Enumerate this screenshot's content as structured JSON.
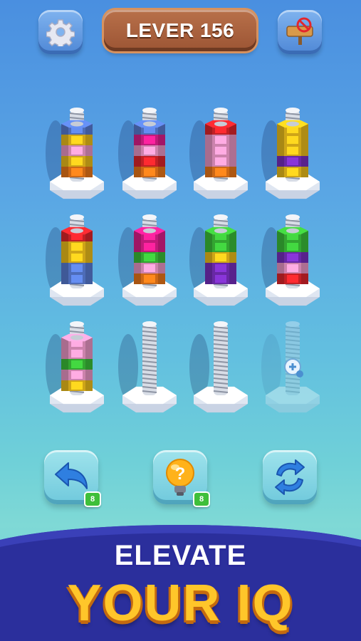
{
  "header": {
    "level_label": "LEVER 156",
    "settings_icon": "gear-icon",
    "no_ads_icon": "no-ads-icon"
  },
  "board": {
    "rows": [
      [
        {
          "nuts": [
            "orange",
            "yellow",
            "pink",
            "yellow",
            "blue"
          ]
        },
        {
          "nuts": [
            "orange",
            "red",
            "pink",
            "magenta",
            "blue"
          ]
        },
        {
          "nuts": [
            "orange",
            "pink",
            "pink",
            "pink",
            "red"
          ]
        },
        {
          "nuts": [
            "yellow",
            "purple",
            "yellow",
            "yellow",
            "yellow"
          ]
        }
      ],
      [
        {
          "nuts": [
            "blue",
            "blue",
            "yellow",
            "yellow",
            "red"
          ]
        },
        {
          "nuts": [
            "orange",
            "pink",
            "green",
            "magenta",
            "magenta"
          ]
        },
        {
          "nuts": [
            "purple",
            "purple",
            "yellow",
            "green",
            "green"
          ]
        },
        {
          "nuts": [
            "red",
            "pink",
            "purple",
            "green",
            "green"
          ]
        }
      ],
      [
        {
          "nuts": [
            "yellow",
            "pink",
            "green",
            "pink",
            "pink"
          ]
        },
        {
          "nuts": []
        },
        {
          "nuts": []
        },
        {
          "nuts": [],
          "locked": true
        }
      ]
    ],
    "colors": {
      "orange": "#f07a1a",
      "yellow": "#f2c21c",
      "pink": "#f09acb",
      "blue": "#5a7fd8",
      "red": "#e3262c",
      "magenta": "#e21f8f",
      "purple": "#7a2fc2",
      "green": "#3cc23a"
    }
  },
  "tools": {
    "undo": {
      "icon": "undo-arrow-icon",
      "count": "8"
    },
    "hint": {
      "icon": "lightbulb-icon",
      "count": "8"
    },
    "shuffle": {
      "icon": "shuffle-icon"
    }
  },
  "banner": {
    "line1": "ELEVATE",
    "line2": "YOUR IQ"
  },
  "accent": {
    "banner_color": "#2b2f9c",
    "tagline_color": "#ffc62a"
  }
}
